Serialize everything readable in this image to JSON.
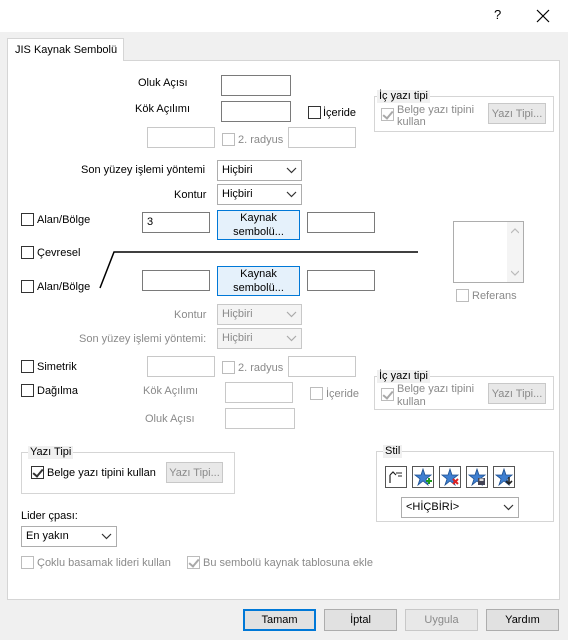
{
  "titlebar": {
    "help": "?",
    "close": "✕"
  },
  "tab": {
    "label": "JIS Kaynak Sembolü"
  },
  "upper": {
    "oluk_acisi_label": "Oluk Açısı",
    "kok_acilimi_label": "Kök Açılımı",
    "iceride_label": "İçeride",
    "ikinci_radyus_label": "2. radyus",
    "son_yuzey_label": "Son yüzey işlemi yöntemi",
    "son_yuzey_value": "Hiçbiri",
    "kontur_label": "Kontur",
    "kontur_value": "Hiçbiri",
    "ic_yazi_tipi": {
      "legend": "İç yazı tipi",
      "belge_label_1": "Belge yazı tipini",
      "belge_label_2": "kullan",
      "yazi_tipi_button": "Yazı Tipi..."
    }
  },
  "middle": {
    "alan_bolge_label": "Alan/Bölge",
    "field_value": "3",
    "kaynak_button": "Kaynak sembolü...",
    "cevresel_label": "Çevresel",
    "alan_bolge_label_2": "Alan/Bölge",
    "kaynak_button_2": "Kaynak sembolü...",
    "referans_label": "Referans"
  },
  "lower": {
    "kontur_label": "Kontur",
    "kontur_value": "Hiçbiri",
    "son_yuzey_label": "Son yüzey işlemi yöntemi:",
    "son_yuzey_value": "Hiçbiri",
    "simetrik_label": "Simetrik",
    "ikinci_radyus_label": "2. radyus",
    "dagilma_label": "Dağılma",
    "kok_acilimi_label": "Kök Açılımı",
    "iceride_label": "İçeride",
    "oluk_acisi_label": "Oluk Açısı",
    "ic_yazi_tipi": {
      "legend": "İç yazı tipi",
      "belge_label_1": "Belge yazı tipini",
      "belge_label_2": "kullan",
      "yazi_tipi_button": "Yazı Tipi..."
    }
  },
  "yazi_tipi": {
    "legend": "Yazı Tipi",
    "belge_label": "Belge yazı tipini kullan",
    "button": "Yazı Tipi..."
  },
  "stil": {
    "legend": "Stil",
    "tools": [
      "style-update-icon",
      "add-style-icon",
      "delete-style-icon",
      "save-style-icon",
      "load-style-icon"
    ],
    "select_value": "<HİÇBİRİ>"
  },
  "lider": {
    "label": "Lider çpası:",
    "value": "En yakın"
  },
  "bottom_options": {
    "coklu_label": "Çoklu basamak lideri kullan",
    "tablo_label": "Bu sembolü kaynak tablosuna ekle"
  },
  "footer": {
    "tamam": "Tamam",
    "iptal": "İptal",
    "uygula": "Uygula",
    "yardim": "Yardım"
  }
}
